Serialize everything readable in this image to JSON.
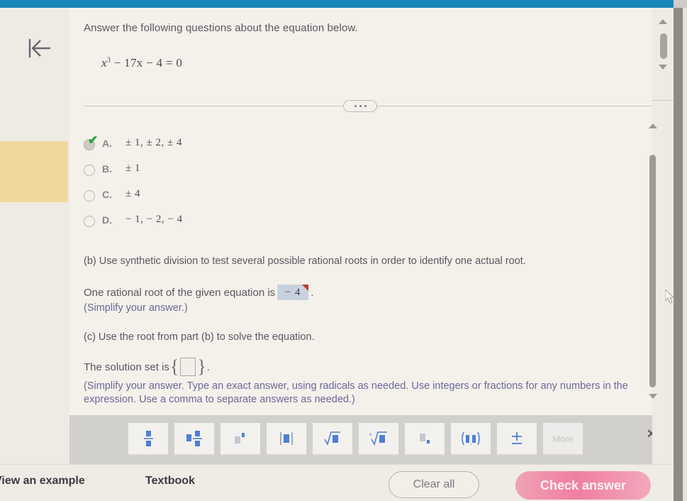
{
  "header": {
    "bar_color": "#1b87b8"
  },
  "nav": {
    "back_icon": "back-to-start-icon"
  },
  "question": {
    "prompt": "Answer the following questions about the equation below.",
    "equation_base": "x",
    "equation_exp": "3",
    "equation_rest": " − 17x − 4 = 0",
    "divider_dots": "•••"
  },
  "options": [
    {
      "letter": "A.",
      "text": "± 1, ± 2, ± 4",
      "selected": true,
      "graded": "correct"
    },
    {
      "letter": "B.",
      "text": "± 1",
      "selected": false,
      "graded": ""
    },
    {
      "letter": "C.",
      "text": "± 4",
      "selected": false,
      "graded": ""
    },
    {
      "letter": "D.",
      "text": "− 1, − 2, − 4",
      "selected": false,
      "graded": ""
    }
  ],
  "part_b": {
    "instruction": "(b) Use synthetic division to test several possible rational roots in order to identify one actual root.",
    "sentence_prefix": "One rational root of the given equation is",
    "answer_value": "− 4",
    "sentence_suffix": ".",
    "hint": "(Simplify your answer.)",
    "answer_flag": "incorrect-corner-marker",
    "answer_flag_color": "#c0392b",
    "answer_fill_color": "#c8d2de"
  },
  "part_c": {
    "instruction": "(c) Use the root from part (b) to solve the equation.",
    "sentence_prefix": "The solution set is",
    "brace_open": "{",
    "answer_value": "",
    "brace_close": "}",
    "sentence_suffix": ".",
    "hint": "(Simplify your answer. Type an exact answer, using radicals as needed. Use integers or fractions for any numbers in the expression. Use a comma to separate answers as needed.)"
  },
  "keypad": {
    "keys": [
      {
        "name": "fraction-key",
        "label": "■/■"
      },
      {
        "name": "mixed-number-key",
        "label": "■ ■/■"
      },
      {
        "name": "exponent-key",
        "label": "■ʸ"
      },
      {
        "name": "absolute-value-key",
        "label": "|■|"
      },
      {
        "name": "square-root-key",
        "label": "√■"
      },
      {
        "name": "nth-root-key",
        "label": "ⁿ√■"
      },
      {
        "name": "subscript-key",
        "label": "■ₓ"
      },
      {
        "name": "parentheses-key",
        "label": "(■,■)"
      },
      {
        "name": "plus-minus-key",
        "label": "±"
      },
      {
        "name": "more-key",
        "label": "More"
      }
    ],
    "close_label": "✕"
  },
  "footer": {
    "view_example": "View an example",
    "textbook": "Textbook",
    "clear_all": "Clear all",
    "check_answer": "Check answer",
    "check_answer_color": "#ef7fa0"
  },
  "scrollbars": {
    "outer": {
      "up": "▲",
      "down": "▼"
    },
    "inner": {
      "up": "▲",
      "down": "▼"
    }
  },
  "sidebar": {
    "highlight_color": "#efd89d"
  }
}
